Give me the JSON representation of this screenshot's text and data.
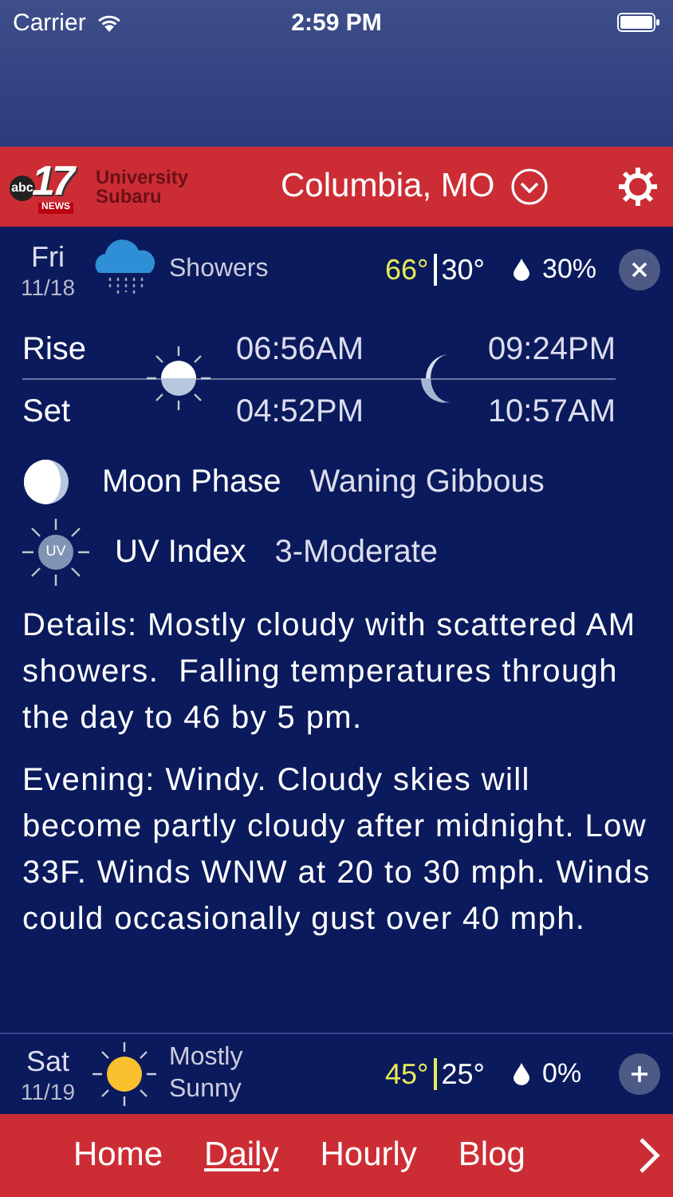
{
  "status_bar": {
    "carrier": "Carrier",
    "time": "2:59 PM"
  },
  "header": {
    "logo": {
      "number": "17",
      "network": "abc",
      "tag": "NEWS",
      "sponsor": "University Subaru"
    },
    "location": "Columbia, MO"
  },
  "days": [
    {
      "day": "Fri",
      "date": "11/18",
      "kind": "showers",
      "condition": "Showers",
      "high": "66°",
      "low": "30°",
      "precip": "30%",
      "expanded": true,
      "details": {
        "rise_label": "Rise",
        "set_label": "Set",
        "sunrise": "06:56AM",
        "sunset": "04:52PM",
        "moonrise": "09:24PM",
        "moonset": "10:57AM",
        "moon_phase_label": "Moon Phase",
        "moon_phase": "Waning Gibbous",
        "uv_label": "UV Index",
        "uv_icon": "UV",
        "uv": "3-Moderate",
        "paragraphs": [
          "Details: Mostly cloudy with scattered AM showers.  Falling temperatures through the day to 46 by 5 pm.",
          "Evening: Windy. Cloudy skies will become partly cloudy after midnight. Low 33F. Winds WNW at 20 to 30 mph. Winds could occasionally gust over 40 mph."
        ]
      }
    },
    {
      "day": "Sat",
      "date": "11/19",
      "kind": "sunny",
      "condition": "Mostly Sunny",
      "high": "45°",
      "low": "25°",
      "precip": "0%",
      "expanded": false
    }
  ],
  "nav": [
    {
      "label": "Home",
      "selected": false
    },
    {
      "label": "Daily",
      "selected": true
    },
    {
      "label": "Hourly",
      "selected": false
    },
    {
      "label": "Blog",
      "selected": false
    }
  ]
}
